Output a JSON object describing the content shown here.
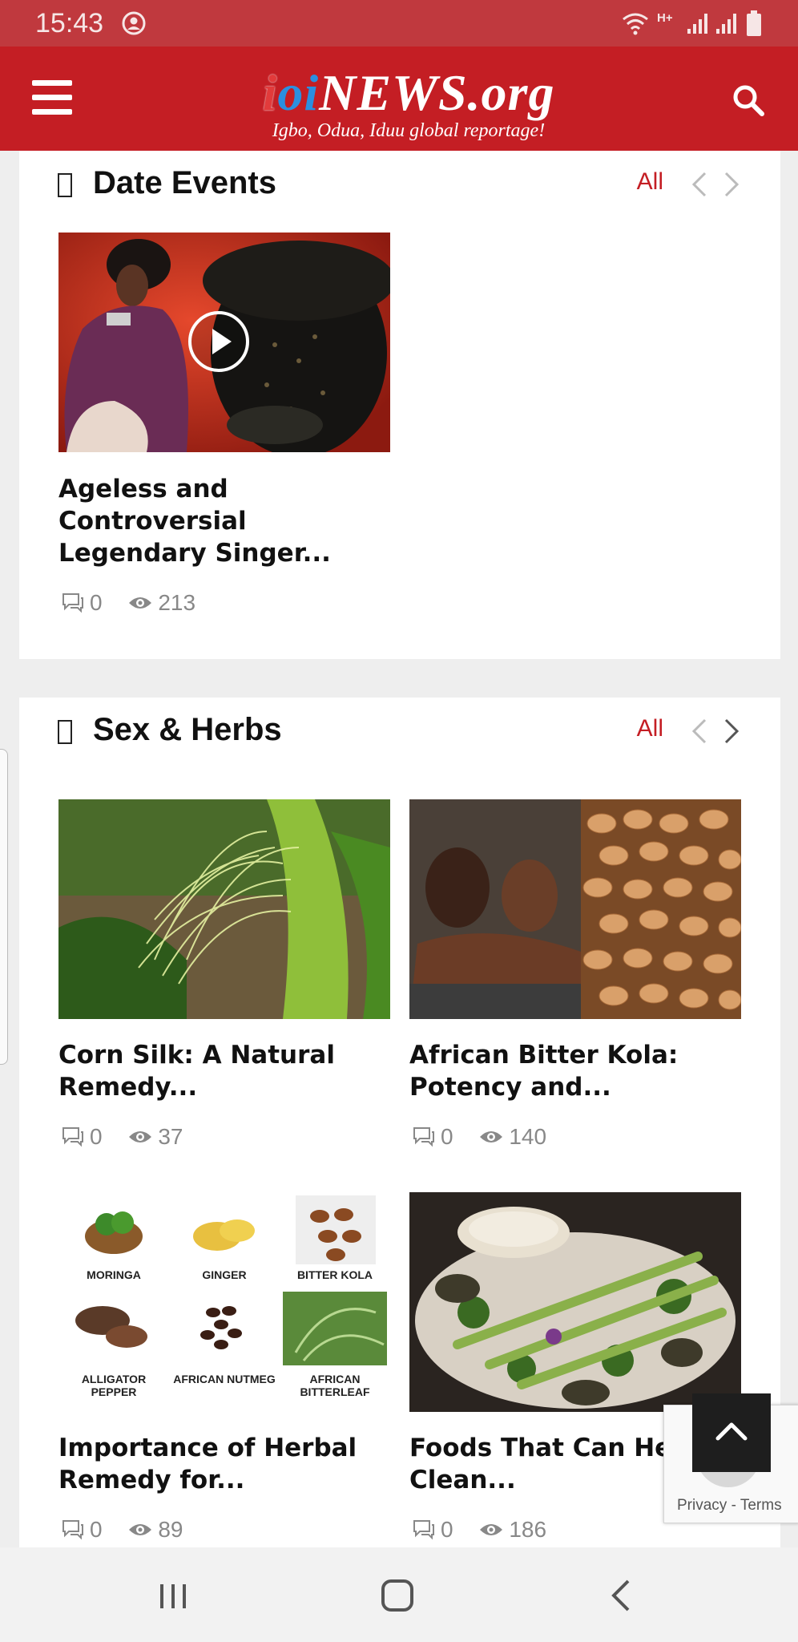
{
  "status_bar": {
    "time": "15:43",
    "network": "H+"
  },
  "header": {
    "logo_part1": "i",
    "logo_part2": "oi",
    "logo_part3": "NEWS.org",
    "tagline": "Igbo, Odua, Iduu global reportage!",
    "accent_color": "#c41e24"
  },
  "sections": {
    "date_events": {
      "title": "Date Events",
      "all_label": "All",
      "posts": [
        {
          "title": "Ageless and Controversial Legendary Singer...",
          "comments": "0",
          "views": "213"
        }
      ]
    },
    "sex_herbs": {
      "title": "Sex & Herbs",
      "all_label": "All",
      "posts": [
        {
          "title": "Corn Silk: A Natural Remedy...",
          "comments": "0",
          "views": "37"
        },
        {
          "title": "African Bitter Kola: Potency and...",
          "comments": "0",
          "views": "140"
        },
        {
          "title": "Importance of Herbal Remedy for...",
          "comments": "0",
          "views": "89"
        },
        {
          "title": "Foods That Can Help Clean...",
          "comments": "0",
          "views": "186"
        }
      ],
      "herb_labels": [
        "MORINGA",
        "GINGER",
        "BITTER KOLA",
        "ALLIGATOR PEPPER",
        "AFRICAN NUTMEG",
        "AFRICAN BITTERLEAF"
      ]
    }
  },
  "recaptcha": {
    "privacy": "Privacy",
    "separator": " - ",
    "terms": "Terms"
  }
}
